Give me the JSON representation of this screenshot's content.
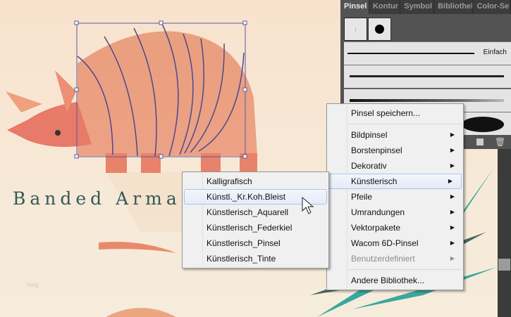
{
  "artwork": {
    "title": "Banded Armad",
    "watermark": "blog"
  },
  "panel": {
    "tabs": [
      "Pinsel",
      "Kontur",
      "Symbol",
      "Bibliothek",
      "Color-Se"
    ],
    "active_tab": "Pinsel",
    "brush_label": "Einfach"
  },
  "main_menu": {
    "items": [
      {
        "label": "Pinsel speichern..."
      },
      {
        "label": "Bildpinsel",
        "submenu": true
      },
      {
        "label": "Borstenpinsel",
        "submenu": true
      },
      {
        "label": "Dekorativ",
        "submenu": true
      },
      {
        "label": "Künstlerisch",
        "submenu": true,
        "highlighted": true
      },
      {
        "label": "Pfeile",
        "submenu": true
      },
      {
        "label": "Umrandungen",
        "submenu": true
      },
      {
        "label": "Vektorpakete",
        "submenu": true
      },
      {
        "label": "Wacom 6D-Pinsel",
        "submenu": true
      },
      {
        "label": "Benutzerdefiniert",
        "submenu": true,
        "disabled": true
      },
      {
        "label": "Andere Bibliothek..."
      }
    ],
    "arrow": "▶"
  },
  "sub_menu": {
    "items": [
      {
        "label": "Kalligrafisch"
      },
      {
        "label": "Künstl._Kr.Koh.Bleist",
        "highlighted": true
      },
      {
        "label": "Künstlerisch_Aquarell"
      },
      {
        "label": "Künstlerisch_Federkiel"
      },
      {
        "label": "Künstlerisch_Pinsel"
      },
      {
        "label": "Künstlerisch_Tinte"
      }
    ]
  }
}
